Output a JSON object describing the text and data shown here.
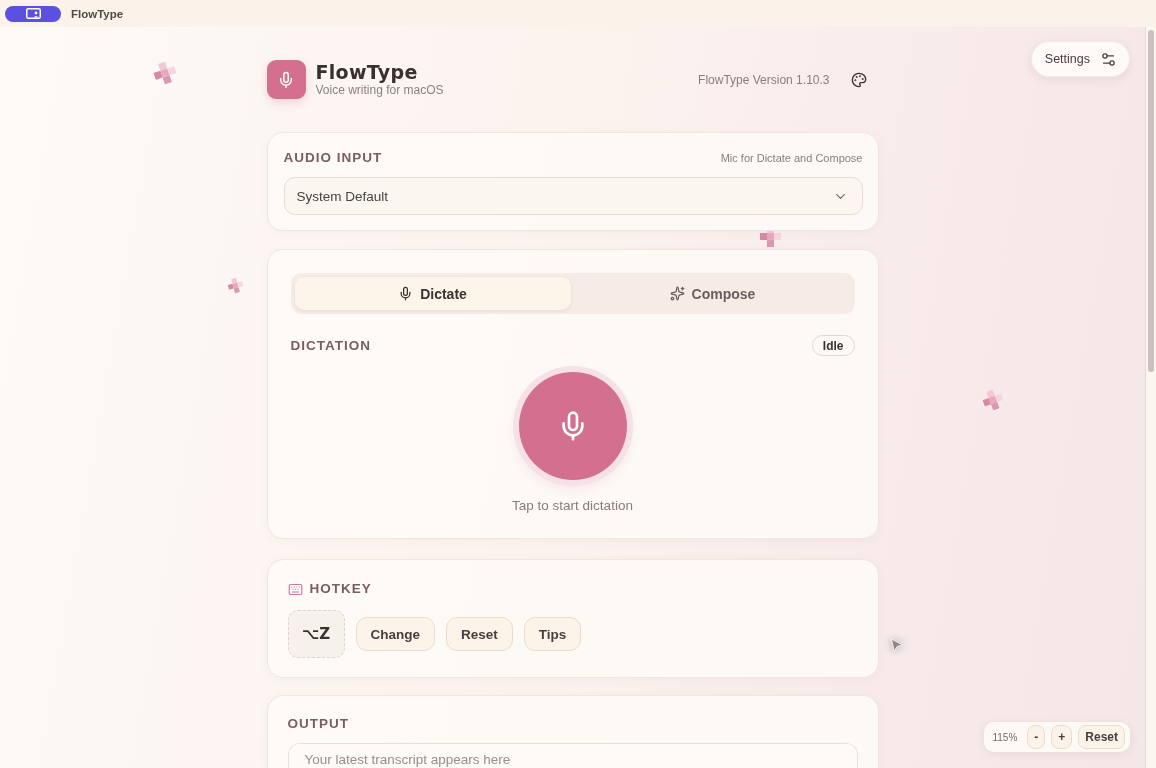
{
  "top_bar": {
    "app_name": "FlowType"
  },
  "header": {
    "title": "FlowType",
    "subtitle": "Voice writing for macOS",
    "version": "FlowType Version 1.10.3"
  },
  "settings_button": {
    "label": "Settings"
  },
  "audio_input": {
    "title": "AUDIO INPUT",
    "hint": "Mic for Dictate and Compose",
    "device": {
      "value": "System Default"
    }
  },
  "mode_tabs": [
    {
      "label": "Dictate",
      "selected": true
    },
    {
      "label": "Compose",
      "selected": false
    }
  ],
  "dictation": {
    "title": "DICTATION",
    "status": "Idle",
    "prompt": "Tap to start dictation"
  },
  "hotkey": {
    "title": "HOTKEY",
    "key": "⌥Z",
    "buttons": [
      "Change",
      "Reset",
      "Tips"
    ]
  },
  "output": {
    "title": "OUTPUT",
    "placeholder": "Your latest transcript appears here"
  },
  "zoom_control": {
    "level_text": "115%",
    "buttons": [
      "-",
      "+",
      "Reset"
    ]
  }
}
